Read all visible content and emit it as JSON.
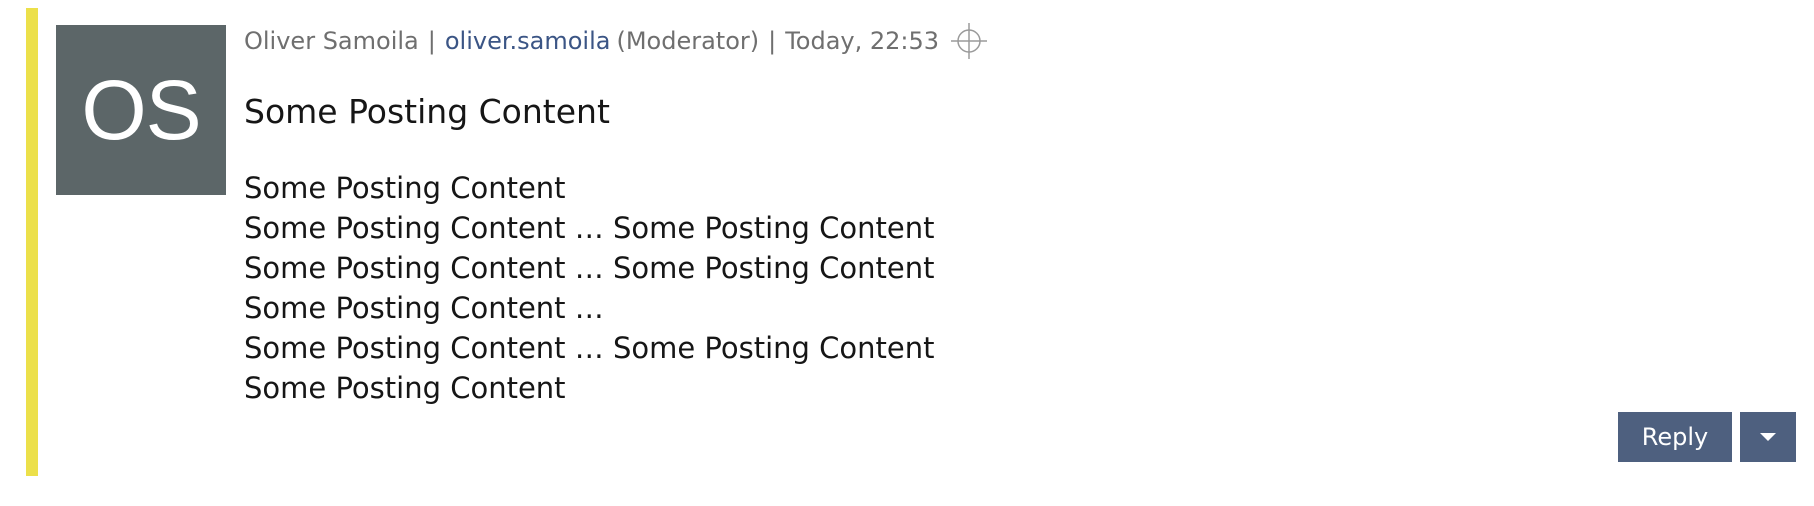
{
  "posting": {
    "accent_color": "#ece04a",
    "avatar": {
      "initials": "OS",
      "background": "#5c6668"
    },
    "meta": {
      "full_name": "Oliver Samoila",
      "separator": "|",
      "username": "oliver.samoila",
      "role": "(Moderator)",
      "timestamp": "Today, 22:53",
      "permalink_icon": "crosshair-icon"
    },
    "title": "Some Posting Content",
    "body_lines": [
      "Some Posting Content",
      "Some Posting Content … Some Posting Content",
      "Some Posting Content … Some Posting Content",
      "Some Posting Content …",
      "Some Posting Content … Some Posting Content",
      "Some Posting Content"
    ],
    "actions": {
      "reply_label": "Reply",
      "more_icon": "caret-down-icon",
      "button_color": "#4e607f"
    }
  }
}
